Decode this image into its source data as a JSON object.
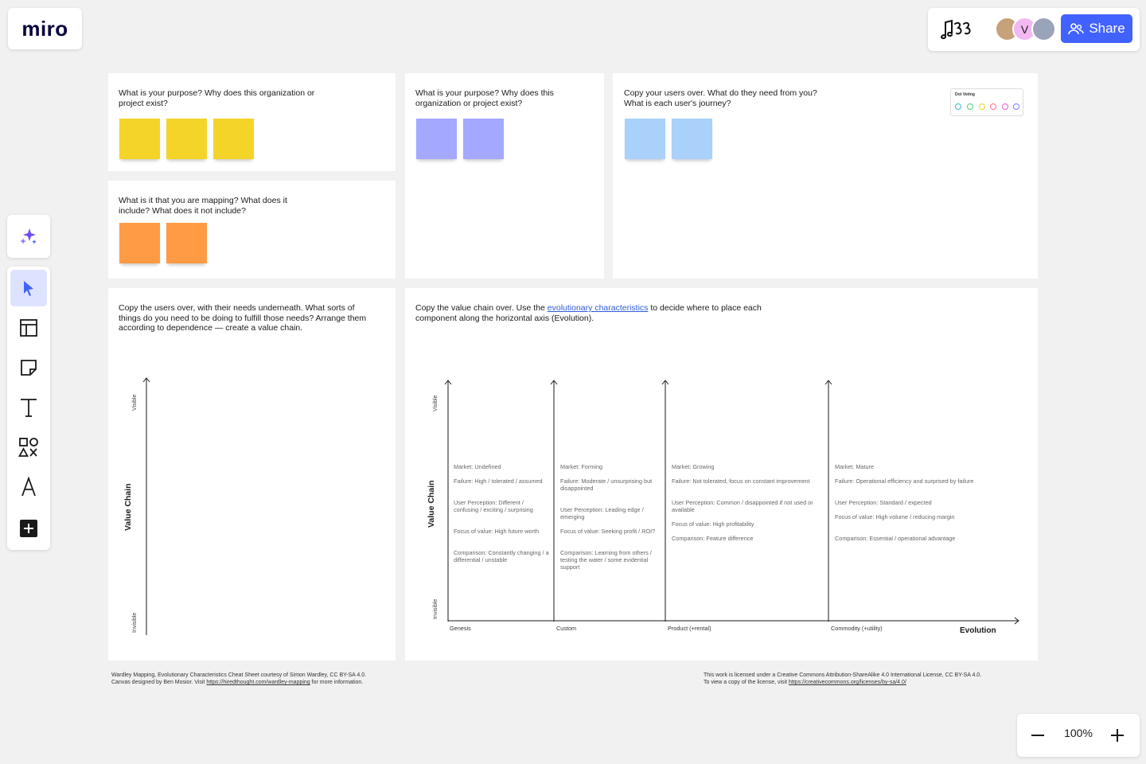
{
  "app": {
    "logo": "miro"
  },
  "top_bar": {
    "board_icon": "board-doodle-icon",
    "avatars": [
      {
        "initial": "",
        "color": "#c7a17a"
      },
      {
        "initial": "V",
        "color": "#f2b8f2"
      },
      {
        "initial": "",
        "color": "#9aa4b8"
      }
    ],
    "share_label": "Share"
  },
  "toolbar": {
    "tools": [
      "ai-sparkle",
      "select",
      "templates",
      "sticky-note",
      "text",
      "shapes",
      "pen",
      "more"
    ]
  },
  "zoom": {
    "value": "100%"
  },
  "frames": {
    "purpose": {
      "prompt": "What is your purpose? Why does this organization or project exist?",
      "sticky_color": "#f5d42a",
      "sticky_count": 3
    },
    "mapping": {
      "prompt": "What is it that you are mapping? What does it include? What does it not include?",
      "sticky_color": "#ff9b45",
      "sticky_count": 2
    },
    "purpose2": {
      "prompt": "What is your purpose? Why does this organization or project exist?",
      "sticky_color": "#a4a8ff",
      "sticky_count": 2
    },
    "users": {
      "prompt": "Copy your users over. What do they need from you? What is each user's journey?",
      "sticky_color": "#a9d1fa",
      "sticky_count": 2
    },
    "value_chain": {
      "prompt": "Copy the users over, with their needs underneath. What sorts of things do you need to be doing to fulfill those needs? Arrange them according to dependence — create a value chain.",
      "axis_top": "Visible",
      "axis_bottom": "Invisible",
      "axis_title": "Value Chain"
    },
    "evolution": {
      "prompt_before": "Copy the value chain over. Use the",
      "prompt_link": "evolutionary characteristics",
      "prompt_after": "to decide where to place each component along the horizontal axis (Evolution).",
      "axis_top": "Visible",
      "axis_bottom": "Invisible",
      "axis_title": "Value Chain",
      "x_title": "Evolution",
      "stages": [
        {
          "name": "Genesis",
          "market": "Market: Undefined",
          "failure": "Failure: High / tolerated / assumed",
          "perception": "User Perception: Different / confusing / exciting / surprising",
          "focus": "Focus of value: High future worth",
          "comparison": "Comparison: Constantly changing / a differential / unstable"
        },
        {
          "name": "Custom",
          "market": "Market: Forming",
          "failure": "Failure: Moderate / unsurprising but disappointed",
          "perception": "User Perception: Leading edge / emerging",
          "focus": "Focus of value: Seeking profit / ROI?",
          "comparison": "Comparison: Learning from others / testing the water / some evidential support"
        },
        {
          "name": "Product (+rental)",
          "market": "Market: Growing",
          "failure": "Failure: Not tolerated, focus on constant improvement",
          "perception": "User Perception: Common / disappointed if not used or available",
          "focus": "Focus of value: High profitability",
          "comparison": "Comparison: Feature difference"
        },
        {
          "name": "Commodity (+utility)",
          "market": "Market: Mature",
          "failure": "Failure: Operational efficiency and surprised by failure",
          "perception": "User Perception: Standard / expected",
          "focus": "Focus of value: High volume / reducing margin",
          "comparison": "Comparison: Essential / operational advantage"
        }
      ]
    }
  },
  "dot_voting": {
    "title": "Dot Voting",
    "colors": [
      "#3fb7c9",
      "#4bd37b",
      "#f5d42a",
      "#ff6b8a",
      "#e35de0",
      "#7b7bff"
    ]
  },
  "footer": {
    "left_line1": "Wardley Mapping, Evolutionary Characteristics Cheat Sheet courtesy of Simon Wardley, CC BY-SA 4.0.",
    "left_line2_before": "Canvas designed by Ben Mosior. Visit",
    "left_link": "https://hiredthought.com/wardley-mapping",
    "left_line2_after": "for more information.",
    "right_line1": "This work is licensed under a Creative Commons Attribution-ShareAlike 4.0 International License, CC BY-SA 4.0.",
    "right_line2_before": "To view a copy of the license, visit",
    "right_link": "https://creativecommons.org/licenses/by-sa/4.0/"
  }
}
